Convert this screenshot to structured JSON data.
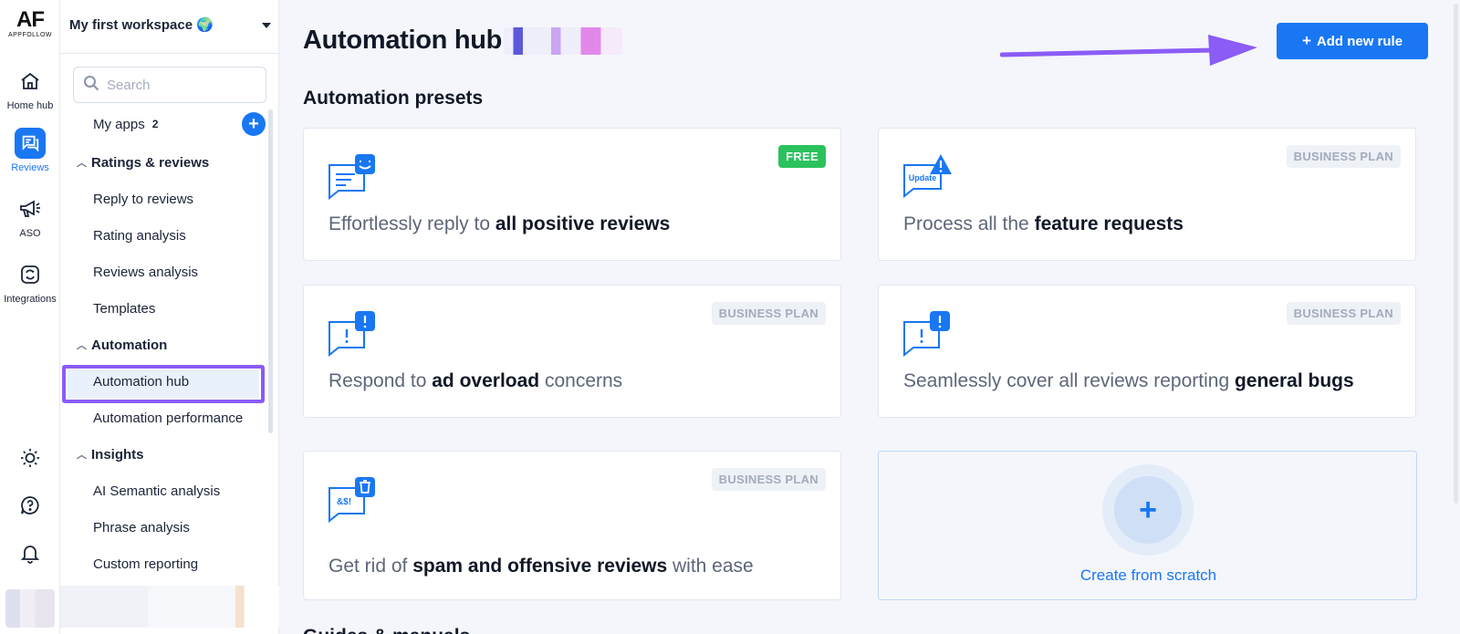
{
  "brand": {
    "logo_text": "AF",
    "logo_subtext": "APPFOLLOW"
  },
  "rail": {
    "items": [
      {
        "label": "Home hub",
        "icon": "home-icon"
      },
      {
        "label": "Reviews",
        "icon": "reviews-chat-icon",
        "active": true
      },
      {
        "label": "ASO",
        "icon": "megaphone-icon"
      },
      {
        "label": "Integrations",
        "icon": "integrations-icon"
      }
    ],
    "bottom_icons": [
      "theme-sun-icon",
      "help-icon",
      "notifications-bell-icon"
    ]
  },
  "sidebar": {
    "workspace": "My first workspace 🌍",
    "search_placeholder": "Search",
    "my_apps": {
      "label": "My apps",
      "count": "2"
    },
    "sections": [
      {
        "title": "Ratings & reviews",
        "items": [
          "Reply to reviews",
          "Rating analysis",
          "Reviews analysis",
          "Templates"
        ]
      },
      {
        "title": "Automation",
        "items": [
          "Automation hub",
          "Automation performance"
        ]
      },
      {
        "title": "Insights",
        "items": [
          "AI Semantic analysis",
          "Phrase analysis",
          "Custom reporting"
        ]
      }
    ],
    "selected_item": "Automation hub"
  },
  "main": {
    "title": "Automation hub",
    "add_rule_button": {
      "plus": "+",
      "label": "Add new rule"
    },
    "presets_title": "Automation presets",
    "presets": [
      {
        "pre": "Effortlessly reply to ",
        "bold": "all positive reviews",
        "post": "",
        "badge": "FREE",
        "badge_type": "free",
        "icon": "positive-review-icon"
      },
      {
        "pre": "Process all the ",
        "bold": "feature requests",
        "post": "",
        "badge": "BUSINESS PLAN",
        "badge_type": "biz",
        "icon": "feature-update-icon",
        "icon_text": "Update"
      },
      {
        "pre": "Respond to ",
        "bold": "ad overload",
        "post": " concerns",
        "badge": "BUSINESS PLAN",
        "badge_type": "biz",
        "icon": "alert-review-icon"
      },
      {
        "pre": "Seamlessly cover all reviews reporting ",
        "bold": "general bugs",
        "post": "",
        "badge": "BUSINESS PLAN",
        "badge_type": "biz",
        "icon": "bug-review-icon"
      },
      {
        "pre": "Get rid of ",
        "bold": "spam and offensive reviews",
        "post": " with ease",
        "badge": "BUSINESS PLAN",
        "badge_type": "biz",
        "icon": "spam-delete-icon",
        "icon_text": "&$!"
      }
    ],
    "create_scratch": {
      "plus": "+",
      "label": "Create from scratch"
    },
    "next_section_title": "Guides & manuals"
  },
  "colors": {
    "accent": "#1977f3",
    "highlight": "#8b5cf6",
    "free_badge": "#2bc25d"
  }
}
